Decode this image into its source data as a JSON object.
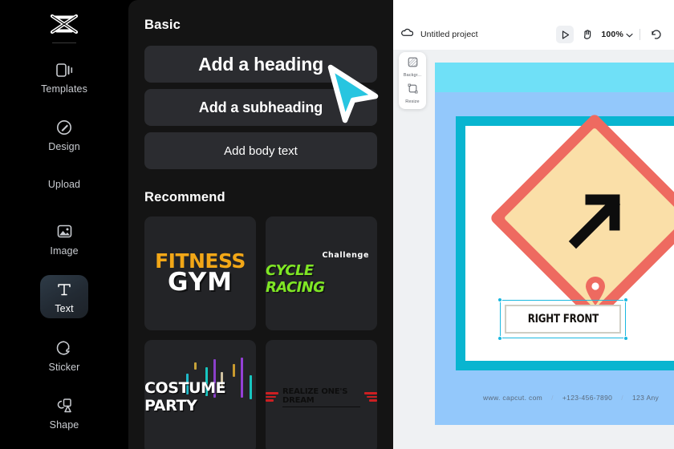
{
  "rail": {
    "logo_icon": "capcut-logo-icon",
    "items": [
      {
        "label": "Templates",
        "icon": "templates-icon",
        "active": false
      },
      {
        "label": "Design",
        "icon": "design-brush-icon",
        "active": false
      },
      {
        "label": "Upload",
        "icon": "upload-icon",
        "active": false
      },
      {
        "label": "Image",
        "icon": "image-icon",
        "active": false
      },
      {
        "label": "Text",
        "icon": "text-t-icon",
        "active": true
      },
      {
        "label": "Sticker",
        "icon": "sticker-icon",
        "active": false
      },
      {
        "label": "Shape",
        "icon": "shape-icon",
        "active": false
      }
    ]
  },
  "panel": {
    "basic_title": "Basic",
    "basic_buttons": [
      {
        "label": "Add a heading"
      },
      {
        "label": "Add a subheading"
      },
      {
        "label": "Add body text"
      }
    ],
    "recommend_title": "Recommend",
    "cards": [
      {
        "name": "fitness-gym",
        "line1": "FITNESS",
        "line2": "GYM",
        "color1": "#F2A717",
        "color2": "#FFFFFF"
      },
      {
        "name": "cycle-racing",
        "line1": "Challenge",
        "line2": "CYCLE RACING",
        "color1": "#FFFFFF",
        "color2": "#7FE625"
      },
      {
        "name": "costume-party",
        "line1": "COSTUME PARTY",
        "line2": "",
        "color1": "#FFFFFF",
        "color2": "#FFFFFF"
      },
      {
        "name": "realize-dream",
        "line1": "REALIZE ONE'S DREAM",
        "line2": "",
        "color1": "#0D0D0D",
        "color2": "#CC1F22"
      }
    ]
  },
  "editor": {
    "topbar": {
      "cloud_icon": "cloud-save-icon",
      "project_name": "Untitled project",
      "select_icon": "cursor-select-icon",
      "hand_icon": "hand-pan-icon",
      "zoom_level": "100%",
      "chevron_icon": "chevron-down-icon",
      "undo_icon": "undo-icon"
    },
    "minitool": [
      {
        "label": "Backgr...",
        "icon": "background-checker-icon"
      },
      {
        "label": "Resize",
        "icon": "resize-frame-icon"
      }
    ],
    "canvas": {
      "sign_label": "diagonal-arrow-sign",
      "textbox_value": "RIGHT FRONT",
      "footer": [
        "www. capcut. com",
        "/",
        "+123-456-7890",
        "/",
        "123 Any"
      ],
      "colors": {
        "outer_cyan": "#6FE0F7",
        "band_blue": "#93C8FB",
        "frame_teal": "#09B5D0",
        "sign_border": "#EE6A60",
        "sign_fill": "#FADFA8",
        "selection": "#19B8E0"
      }
    }
  },
  "cursor": {
    "name": "mouse-pointer",
    "color": "#27C5E0"
  }
}
